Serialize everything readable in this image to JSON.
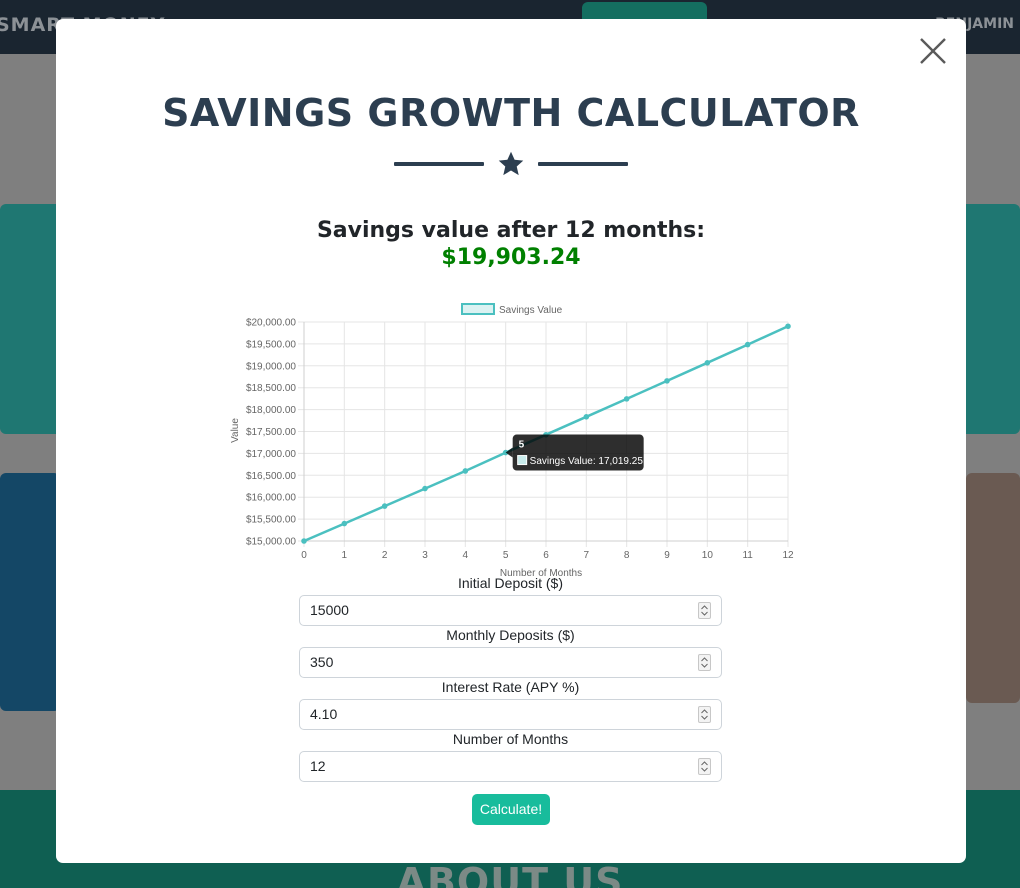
{
  "background": {
    "brand": "SMART MONEY",
    "user": "BENJAMIN",
    "about_title": "ABOUT US"
  },
  "modal": {
    "title": "SAVINGS GROWTH CALCULATOR",
    "result_label": "Savings value after 12 months:",
    "result_value": "$19,903.24",
    "close_icon": "close-icon",
    "divider_icon": "star-icon"
  },
  "chart_data": {
    "type": "line",
    "x": [
      0,
      1,
      2,
      3,
      4,
      5,
      6,
      7,
      8,
      9,
      10,
      11,
      12
    ],
    "series": [
      {
        "name": "Savings Value",
        "values": [
          15000,
          15398,
          15797,
          16197,
          16599,
          17019.25,
          17426,
          17835,
          18245,
          18656,
          19068,
          19484,
          19903.24
        ]
      }
    ],
    "xlabel": "Number of Months",
    "ylabel": "Value",
    "ylim": [
      15000,
      20000
    ],
    "y_ticks": [
      "$20,000.00",
      "$19,500.00",
      "$19,000.00",
      "$18,500.00",
      "$18,000.00",
      "$17,500.00",
      "$17,000.00",
      "$16,500.00",
      "$16,000.00",
      "$15,500.00",
      "$15,000.00"
    ],
    "x_ticks": [
      "0",
      "1",
      "2",
      "3",
      "4",
      "5",
      "6",
      "7",
      "8",
      "9",
      "10",
      "11",
      "12"
    ],
    "legend": "top",
    "grid": true,
    "line_color": "#4bc0c0",
    "tooltip": {
      "title": "5",
      "label": "Savings Value: 17,019.25",
      "x": 5
    }
  },
  "form": {
    "fields": [
      {
        "label": "Initial Deposit ($)",
        "value": "15000"
      },
      {
        "label": "Monthly Deposits ($)",
        "value": "350"
      },
      {
        "label": "Interest Rate (APY %)",
        "value": "4.10"
      },
      {
        "label": "Number of Months",
        "value": "12"
      }
    ],
    "submit_label": "Calculate!"
  },
  "colors": {
    "title": "#2c3e50",
    "result_value": "#008000",
    "button": "#18bc9c"
  }
}
